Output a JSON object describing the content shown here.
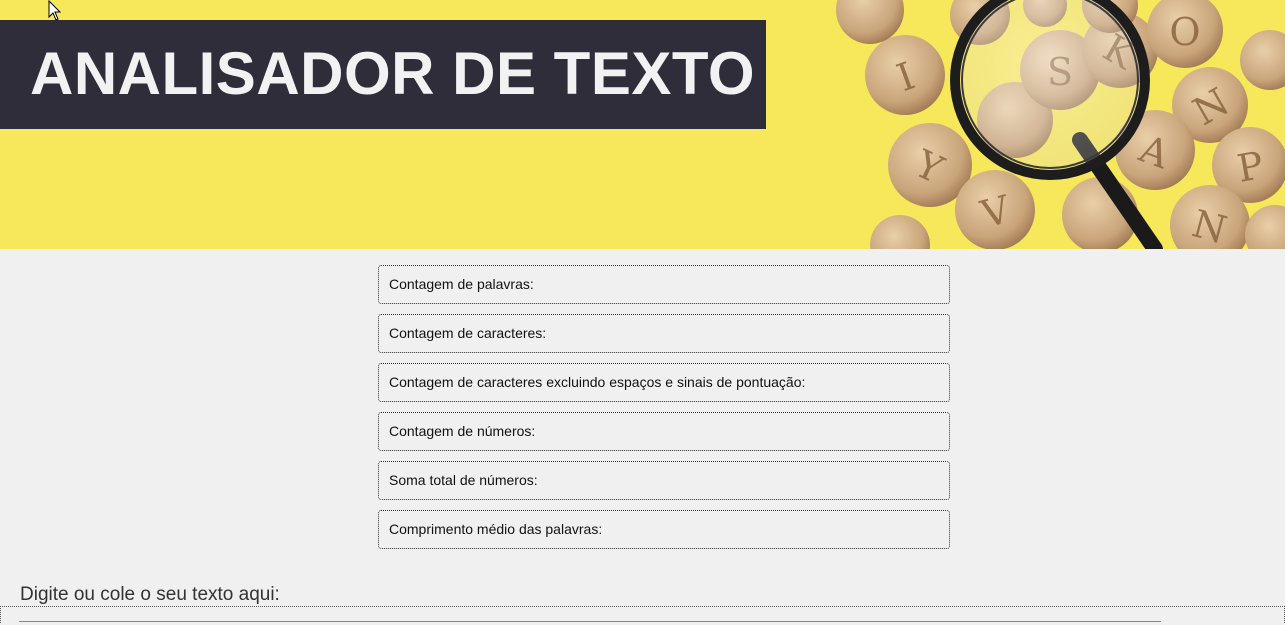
{
  "header": {
    "title": "ANALISADOR DE TEXTO",
    "image_icon": "magnifying-glass-letter-tiles-image",
    "background_color": "#f7e75a",
    "title_bg_color": "#302d3a"
  },
  "stats": [
    {
      "label": "Contagem de palavras:",
      "value": ""
    },
    {
      "label": "Contagem de caracteres:",
      "value": ""
    },
    {
      "label": "Contagem de caracteres excluindo espaços e sinais de pontuação:",
      "value": ""
    },
    {
      "label": "Contagem de números:",
      "value": ""
    },
    {
      "label": "Soma total de números:",
      "value": ""
    },
    {
      "label": "Comprimento médio das palavras:",
      "value": ""
    }
  ],
  "input": {
    "label": "Digite ou cole o seu texto aqui:",
    "value": "",
    "placeholder": ""
  }
}
